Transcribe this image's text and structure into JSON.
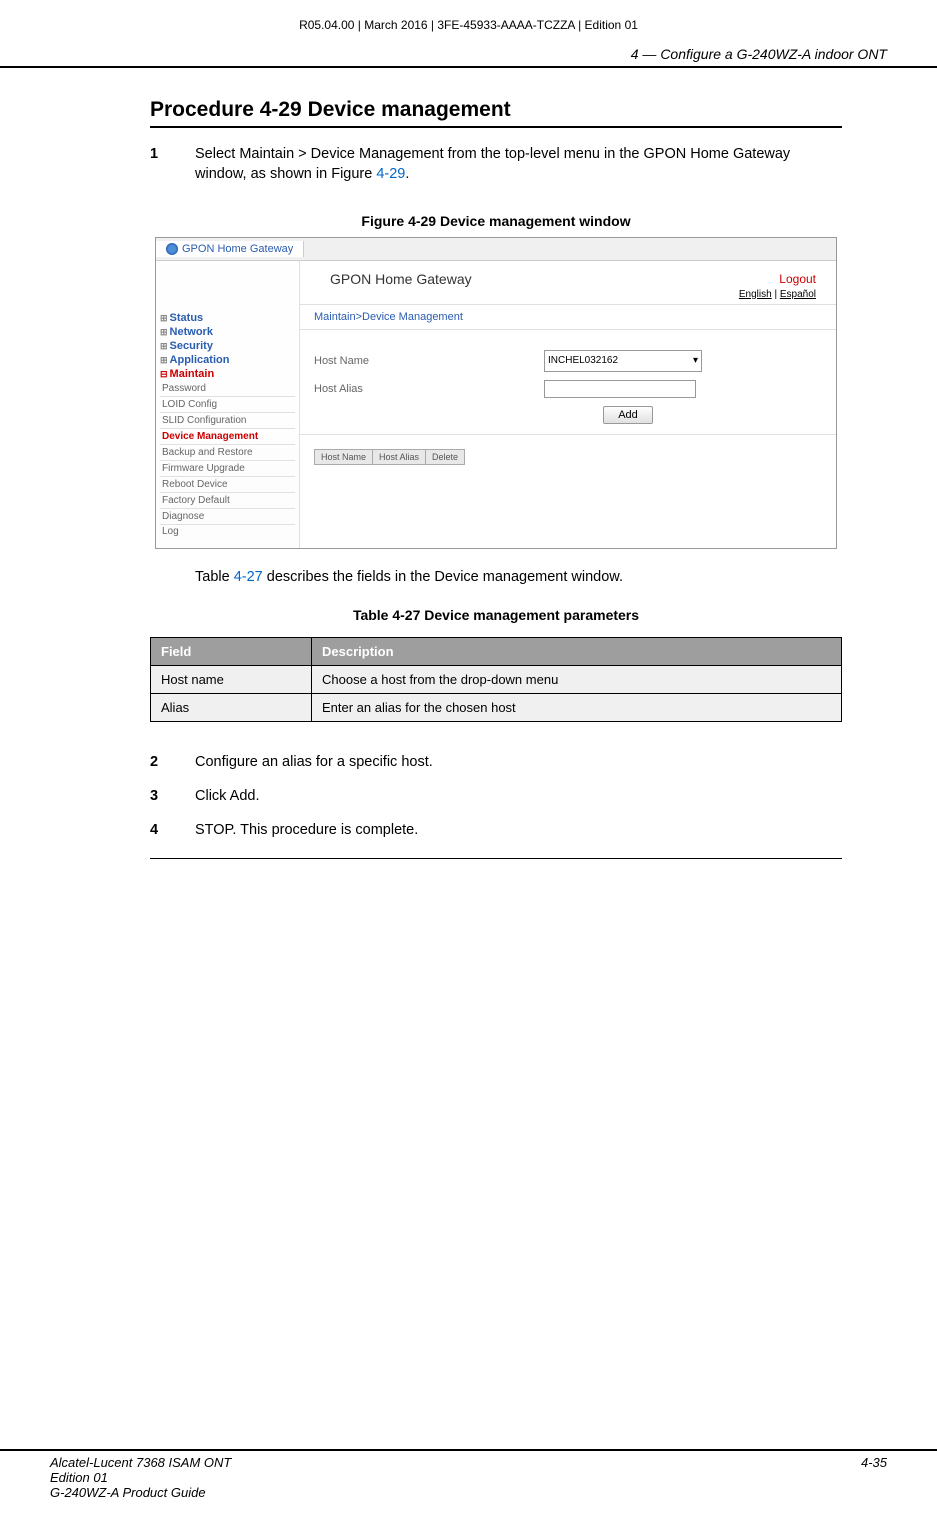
{
  "header_text": "R05.04.00 | March 2016 | 3FE-45933-AAAA-TCZZA | Edition 01",
  "chapter_title": "4 —  Configure a G-240WZ-A indoor ONT",
  "procedure_title": "Procedure 4-29  Device management",
  "step1_num": "1",
  "step1_text_a": "Select Maintain > Device Management from the top-level menu in the GPON Home Gateway window, as shown in Figure ",
  "step1_link": "4-29",
  "step1_text_b": ".",
  "figure_caption": "Figure 4-29  Device management window",
  "figure": {
    "browser_tab": "GPON Home Gateway",
    "app_title": "GPON Home Gateway",
    "logout": "Logout",
    "lang_english": "English",
    "lang_spanish": "Español",
    "breadcrumb": "Maintain>Device Management",
    "sidebar_top": [
      {
        "label": "Status",
        "class": "blue"
      },
      {
        "label": "Network",
        "class": "blue"
      },
      {
        "label": "Security",
        "class": "blue"
      },
      {
        "label": "Application",
        "class": "blue"
      },
      {
        "label": "Maintain",
        "class": "red"
      }
    ],
    "sidebar_sub": [
      {
        "label": "Password"
      },
      {
        "label": "LOID Config"
      },
      {
        "label": "SLID Configuration"
      },
      {
        "label": "Device Management",
        "active": true
      },
      {
        "label": "Backup and Restore"
      },
      {
        "label": "Firmware Upgrade"
      },
      {
        "label": "Reboot Device"
      },
      {
        "label": "Factory Default"
      },
      {
        "label": "Diagnose"
      },
      {
        "label": "Log"
      }
    ],
    "form": {
      "hostname_label": "Host Name",
      "hostname_value": "INCHEL032162",
      "hostalias_label": "Host Alias",
      "add_btn": "Add"
    },
    "mini_table_headers": [
      "Host Name",
      "Host Alias",
      "Delete"
    ]
  },
  "post_figure_a": "Table ",
  "post_figure_link": "4-27",
  "post_figure_b": " describes the fields in the Device management window.",
  "table_caption": "Table 4-27 Device management parameters",
  "table_headers": {
    "field": "Field",
    "desc": "Description"
  },
  "table_rows": [
    {
      "field": "Host name",
      "desc": "Choose a host from the drop-down menu"
    },
    {
      "field": "Alias",
      "desc": "Enter an alias for the chosen host"
    }
  ],
  "step2_num": "2",
  "step2_text": "Configure an alias for a specific host.",
  "step3_num": "3",
  "step3_text": "Click Add.",
  "step4_num": "4",
  "step4_text": "STOP. This procedure is complete.",
  "footer": {
    "line1": "Alcatel-Lucent 7368 ISAM ONT",
    "line2": "Edition 01",
    "line3": "G-240WZ-A Product Guide",
    "page": "4-35"
  }
}
